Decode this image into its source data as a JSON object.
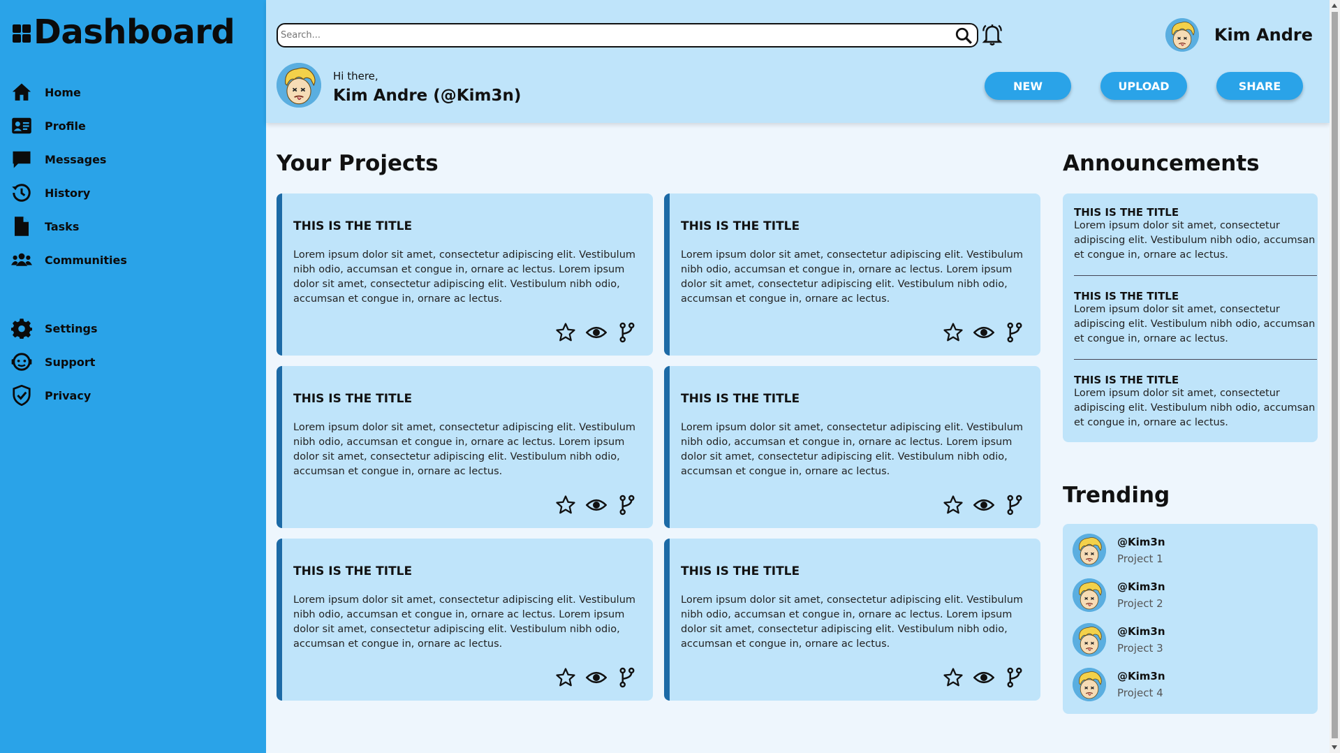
{
  "sidebar": {
    "title": "Dashboard",
    "items": [
      {
        "label": "Home",
        "icon": "home-icon"
      },
      {
        "label": "Profile",
        "icon": "profile-card-icon"
      },
      {
        "label": "Messages",
        "icon": "message-icon"
      },
      {
        "label": "History",
        "icon": "history-icon"
      },
      {
        "label": "Tasks",
        "icon": "file-icon"
      },
      {
        "label": "Communities",
        "icon": "users-icon"
      }
    ],
    "items_bottom": [
      {
        "label": "Settings",
        "icon": "gear-icon"
      },
      {
        "label": "Support",
        "icon": "support-icon"
      },
      {
        "label": "Privacy",
        "icon": "shield-icon"
      }
    ]
  },
  "header": {
    "search_placeholder": "Search...",
    "user_name": "Kim Andre",
    "greeting": "Hi there,",
    "greeting_name": "Kim Andre (@Kim3n)",
    "buttons": {
      "new": "NEW",
      "upload": "UPLOAD",
      "share": "SHARE"
    }
  },
  "projects": {
    "heading": "Your Projects",
    "cards": [
      {
        "title": "THIS IS THE TITLE",
        "body": "Lorem ipsum dolor sit amet, consectetur adipiscing elit. Vestibulum nibh odio, accumsan et congue in, ornare ac lectus. Lorem ipsum dolor sit amet, consectetur adipiscing elit. Vestibulum nibh odio, accumsan et congue in, ornare ac lectus."
      },
      {
        "title": "THIS IS THE TITLE",
        "body": "Lorem ipsum dolor sit amet, consectetur adipiscing elit. Vestibulum nibh odio, accumsan et congue in, ornare ac lectus. Lorem ipsum dolor sit amet, consectetur adipiscing elit. Vestibulum nibh odio, accumsan et congue in, ornare ac lectus."
      },
      {
        "title": "THIS IS THE TITLE",
        "body": "Lorem ipsum dolor sit amet, consectetur adipiscing elit. Vestibulum nibh odio, accumsan et congue in, ornare ac lectus. Lorem ipsum dolor sit amet, consectetur adipiscing elit. Vestibulum nibh odio, accumsan et congue in, ornare ac lectus."
      },
      {
        "title": "THIS IS THE TITLE",
        "body": "Lorem ipsum dolor sit amet, consectetur adipiscing elit. Vestibulum nibh odio, accumsan et congue in, ornare ac lectus. Lorem ipsum dolor sit amet, consectetur adipiscing elit. Vestibulum nibh odio, accumsan et congue in, ornare ac lectus."
      },
      {
        "title": "THIS IS THE TITLE",
        "body": "Lorem ipsum dolor sit amet, consectetur adipiscing elit. Vestibulum nibh odio, accumsan et congue in, ornare ac lectus. Lorem ipsum dolor sit amet, consectetur adipiscing elit. Vestibulum nibh odio, accumsan et congue in, ornare ac lectus."
      },
      {
        "title": "THIS IS THE TITLE",
        "body": "Lorem ipsum dolor sit amet, consectetur adipiscing elit. Vestibulum nibh odio, accumsan et congue in, ornare ac lectus. Lorem ipsum dolor sit amet, consectetur adipiscing elit. Vestibulum nibh odio, accumsan et congue in, ornare ac lectus."
      }
    ],
    "card_actions": [
      "star-icon",
      "eye-icon",
      "fork-icon"
    ]
  },
  "announcements": {
    "heading": "Announcements",
    "items": [
      {
        "title": "THIS IS THE TITLE",
        "body": "Lorem ipsum dolor sit amet, consectetur adipiscing elit. Vestibulum nibh odio, accumsan et congue in, ornare ac lectus."
      },
      {
        "title": "THIS IS THE TITLE",
        "body": "Lorem ipsum dolor sit amet, consectetur adipiscing elit. Vestibulum nibh odio, accumsan et congue in, ornare ac lectus."
      },
      {
        "title": "THIS IS THE TITLE",
        "body": "Lorem ipsum dolor sit amet, consectetur adipiscing elit. Vestibulum nibh odio, accumsan et congue in, ornare ac lectus."
      }
    ]
  },
  "trending": {
    "heading": "Trending",
    "items": [
      {
        "handle": "@Kim3n",
        "project": "Project 1"
      },
      {
        "handle": "@Kim3n",
        "project": "Project 2"
      },
      {
        "handle": "@Kim3n",
        "project": "Project 3"
      },
      {
        "handle": "@Kim3n",
        "project": "Project 4"
      }
    ]
  },
  "colors": {
    "sidebar": "#2aa3e8",
    "header": "#bfe4fa",
    "card": "#bfe4fa",
    "card_accent": "#1c6aa6",
    "background": "#eef6fd",
    "button": "#2aa3e8"
  }
}
